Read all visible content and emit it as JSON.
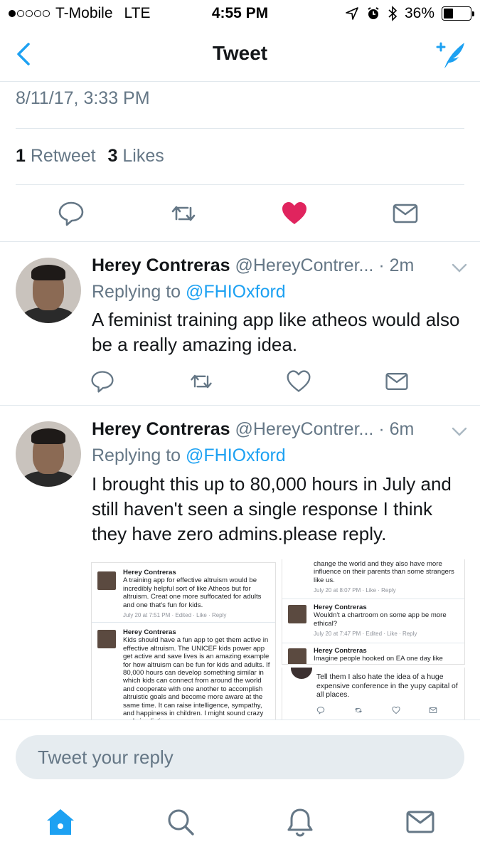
{
  "status_bar": {
    "carrier": "T-Mobile",
    "network": "LTE",
    "time": "4:55 PM",
    "battery": "36%",
    "battery_level": 0.36,
    "signal_bars": 1
  },
  "nav": {
    "title": "Tweet",
    "back_icon": "chevron-left-icon",
    "compose_icon": "compose-tweet-icon"
  },
  "detail": {
    "datetime": "8/11/17, 3:33 PM",
    "retweet_count": "1",
    "retweet_label": "Retweet",
    "like_count": "3",
    "like_label": "Likes"
  },
  "actions": [
    "reply-icon",
    "retweet-icon",
    "like-icon",
    "message-icon"
  ],
  "colors": {
    "accent": "#1da1f2",
    "like": "#e0245e",
    "muted": "#657786",
    "divider": "#e1e8ed"
  },
  "replies": [
    {
      "name": "Herey Contreras",
      "handle": "@HereyContrer...",
      "time": "2m",
      "replying_prefix": "Replying to",
      "replying_to": "@FHIOxford",
      "text": "A feminist training app like atheos would also be a really amazing idea."
    },
    {
      "name": "Herey Contreras",
      "handle": "@HereyContrer...",
      "time": "6m",
      "replying_prefix": "Replying to",
      "replying_to": "@FHIOxford",
      "text": "I brought this up to 80,000 hours in July and still haven't seen a single response I think they have zero admins.please reply."
    }
  ],
  "embedded": {
    "left": [
      {
        "name": "Herey Contreras",
        "text": "A training app for effective altruism would be incredibly helpful sort of like Atheos but for altruism. Creat one more suffocated for adults and one that's fun for kids.",
        "meta": "July 20 at 7:51 PM · Edited · Like · Reply"
      },
      {
        "name": "Herey Contreras",
        "text": "Kids should have a fun app to get them active in effective altruism. The UNICEF kids power app get active and save lives is an amazing example for how altruism can be fun for kids and adults. If 80,000 hours can develop something similar in which kids can connect from around the world and cooperate with one another to accomplish altruistic goals and become more aware at the same time. It can raise intelligence, sympathy, and happiness in children. I might sound crazy and simplistic",
        "meta": ""
      }
    ],
    "right_top": [
      {
        "name": "",
        "text": "change the world and they also have more influence on their parents than some strangers like us.",
        "meta": "July 20 at 8:07 PM · Like · Reply"
      },
      {
        "name": "Herey Contreras",
        "text": "Wouldn't a chartroom on some app be more ethical?",
        "meta": "July 20 at 7:47 PM · Edited · Like · Reply"
      },
      {
        "name": "Herey Contreras",
        "text": "Imagine people hooked on EA one day like",
        "meta": ""
      }
    ],
    "right_bottom": {
      "text": "Tell them I also hate the idea of a huge expensive conference in the yupy capital of all places."
    }
  },
  "reply_bar": {
    "placeholder": "Tweet your reply"
  },
  "tab_bar": [
    "home-icon",
    "search-icon",
    "notifications-icon",
    "messages-icon"
  ]
}
